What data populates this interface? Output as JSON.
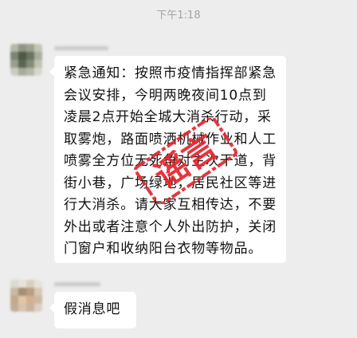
{
  "timestamp": "下午1:18",
  "messages": [
    {
      "text": "紧急通知：按照市疫情指挥部紧急会议安排，今明两晚夜间10点到凌晨2点开始全城大消杀行动，采取雾炮，路面喷洒机械作业和人工喷雾全方位无死角对主次干道，背街小巷，广场绿地，居民社区等进行大消杀。请大家互相传达，不要外出或者注意个人外出防护，关闭门窗户和收纳阳台衣物等物品。"
    },
    {
      "text": "假消息吧"
    }
  ],
  "stamp": {
    "text": "谣言",
    "color": "#e8232b"
  }
}
